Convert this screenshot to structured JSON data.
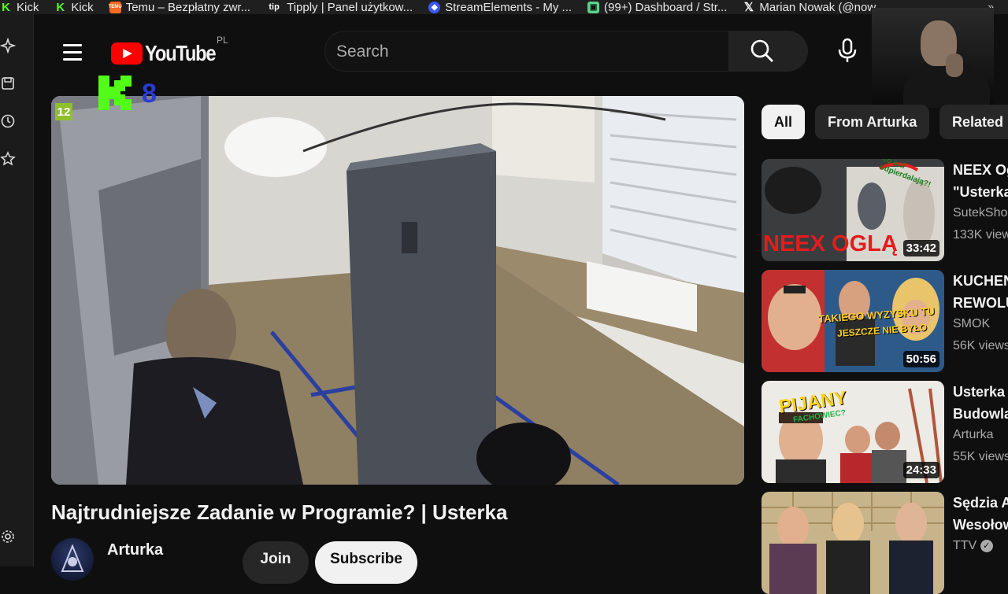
{
  "bookmarks": [
    {
      "label": "Kick",
      "icon": "kick-icon",
      "color": "#53fc18"
    },
    {
      "label": "Kick",
      "icon": "kick-icon",
      "color": "#53fc18"
    },
    {
      "label": "Temu – Bezpłatny zwr...",
      "icon": "temu-icon",
      "color": "#f46a22"
    },
    {
      "label": "Tipply | Panel użytkow...",
      "icon": "tipply-icon",
      "color": "#ffffff"
    },
    {
      "label": "StreamElements - My ...",
      "icon": "streamelements-icon",
      "color": "#3b58ff"
    },
    {
      "label": "(99+) Dashboard / Str...",
      "icon": "twitch-dashboard-icon",
      "color": "#5ad48a"
    },
    {
      "label": "Marian Nowak (@now...",
      "icon": "x-icon",
      "color": "#ffffff"
    }
  ],
  "header": {
    "logo_text": "YouTube",
    "country_code": "PL",
    "search_placeholder": "Search"
  },
  "overlay": {
    "kick_number": "8"
  },
  "video": {
    "age_rating": "12",
    "title": "Najtrudniejsze Zadanie w Programie? | Usterka",
    "channel": "Arturka",
    "join_label": "Join",
    "subscribe_label": "Subscribe"
  },
  "chips": [
    "All",
    "From Arturka",
    "Related"
  ],
  "recommendations": [
    {
      "title": "NEEX Og",
      "title2": "\"Usterka",
      "channel": "SutekSho",
      "views": "133K view",
      "duration": "33:42",
      "thumb_text": "NEEX OGLĄ",
      "thumb_note": "co oni odpierdalają?!"
    },
    {
      "title": "KUCHEN",
      "title2": "REWOLU",
      "channel": "SMOK",
      "views": "56K views",
      "duration": "50:56",
      "thumb_text": "TAKIEGO WYZYSKU TU",
      "thumb_text2": "JESZCZE NIE BYŁO"
    },
    {
      "title": "Usterka",
      "title2": "Budowla",
      "channel": "Arturka",
      "views": "55K views",
      "duration": "24:33",
      "thumb_text": "PIJANY",
      "thumb_text2": "FACHOWIEC?"
    },
    {
      "title": "Sędzia A",
      "title2": "Wesołow",
      "channel": "TTV",
      "views": "",
      "duration": "",
      "verified": true
    }
  ]
}
